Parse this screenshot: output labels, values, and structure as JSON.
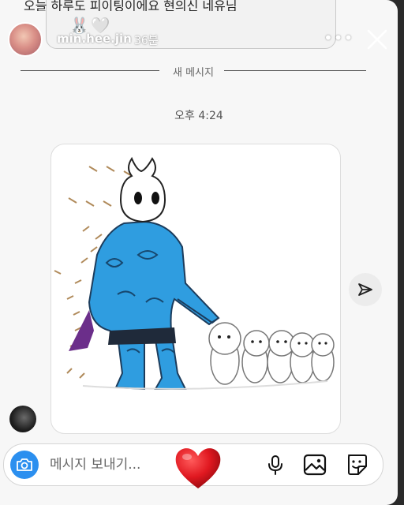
{
  "story": {
    "caption": "오늘 하루도 피이팅이에요 현의신 네유님",
    "emojis": "🐰🤍"
  },
  "header": {
    "username": "min.hee.jin",
    "time_ago": "36분",
    "more_label": "•••"
  },
  "thread": {
    "divider_label": "새 메시지",
    "timestamp": "오후 4:24"
  },
  "composer": {
    "placeholder": "메시지 보내기..."
  },
  "colors": {
    "accent": "#2b8fef",
    "heart": "#e01820",
    "armor": "#2f9de0"
  },
  "icons": [
    "close-icon",
    "more-icon",
    "share-icon",
    "camera-icon",
    "heart-icon",
    "mic-icon",
    "gallery-icon",
    "sticker-icon"
  ]
}
